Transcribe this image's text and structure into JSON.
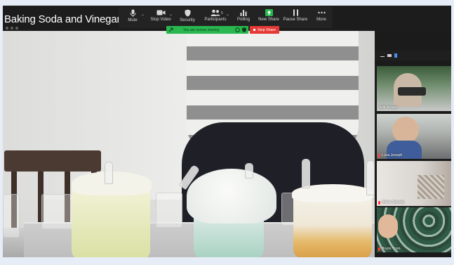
{
  "window": {
    "title": "Baking Soda and Vinegar**.m"
  },
  "share_toolbar": {
    "items": [
      {
        "label": "Mute",
        "icon": "microphone-icon"
      },
      {
        "label": "Stop Video",
        "icon": "video-camera-icon"
      },
      {
        "label": "Security",
        "icon": "shield-icon"
      },
      {
        "label": "Participants",
        "icon": "participants-icon",
        "count": "5"
      },
      {
        "label": "Polling",
        "icon": "bar-chart-icon"
      },
      {
        "label": "New Share",
        "icon": "upload-arrow-icon"
      },
      {
        "label": "Pause Share",
        "icon": "pause-icon"
      },
      {
        "label": "More",
        "icon": "ellipsis-icon"
      }
    ],
    "sharing_status": "You are screen sharing",
    "stop_share_label": "Stop Share",
    "accent_green": "#2ab74f",
    "stop_red": "#e53935"
  },
  "gallery": {
    "participants": [
      {
        "name": "Julie Amaya",
        "muted": false
      },
      {
        "name": "Luca Joseph",
        "muted": true
      },
      {
        "name": "Alden Schreib",
        "muted": true
      },
      {
        "name": "Brynn Yoon",
        "muted": true
      }
    ]
  }
}
